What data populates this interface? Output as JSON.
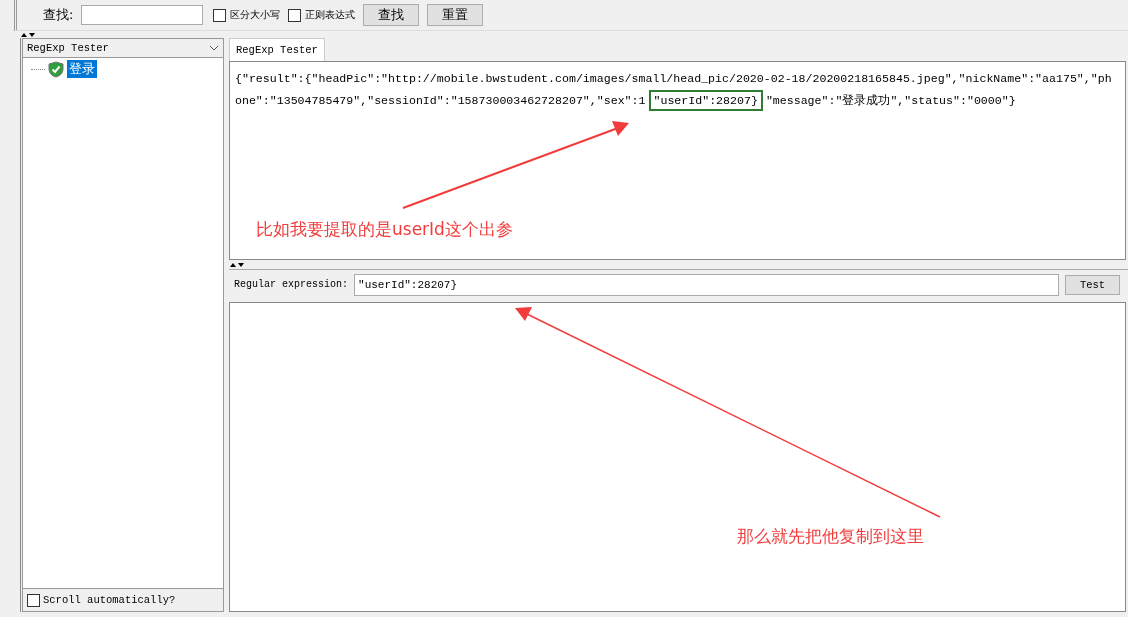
{
  "search_bar": {
    "label": "查找:",
    "checkboxes": [
      {
        "label": "区分大小写",
        "checked": false
      },
      {
        "label": "正则表达式",
        "checked": false
      }
    ],
    "buttons": [
      "查找",
      "重置"
    ]
  },
  "tree_panel": {
    "header": "RegExp Tester",
    "items": [
      {
        "label": "登录",
        "selected": true
      }
    ],
    "scroll_checkbox": {
      "label": "Scroll automatically?",
      "checked": false
    }
  },
  "tabs": [
    {
      "label": "RegExp Tester",
      "selected": true
    }
  ],
  "response": [
    {
      "text": "{\"result\":{\"headPic\":\"http://mobile.bwstudent.com/images/small/head_pic/2020-02-18/20200218165845.jpeg\",\"nickName\":\"aa175\",\"phone\":\"13504785479\",\"sessionId\":\"158730003462728207\",\"sex\":1",
      "boxed": false
    },
    {
      "text": "\"userId\":28207}",
      "boxed": true
    },
    {
      "text": "\"message\":\"登录成功\",\"status\":\"0000\"}",
      "boxed": false
    }
  ],
  "regex": {
    "label": "Regular expression:",
    "value": "\"userId\":28207}",
    "button": "Test"
  },
  "annotations": [
    {
      "text": "比如我要提取的是userId这个出参"
    },
    {
      "text": "那么就先把他复制到这里"
    }
  ]
}
